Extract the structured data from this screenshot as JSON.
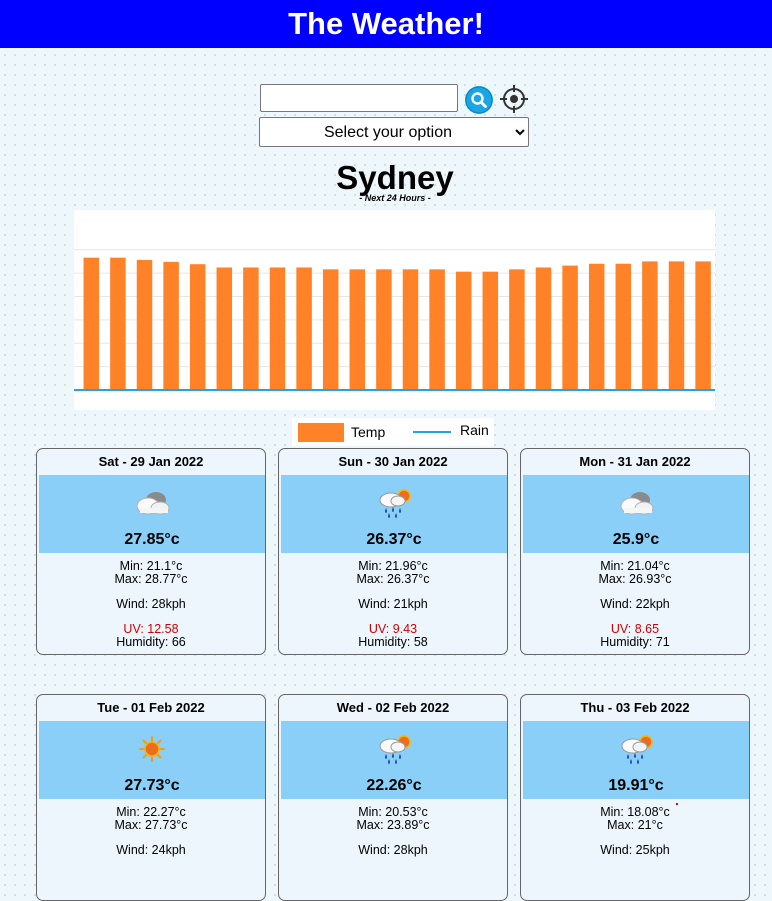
{
  "header": {
    "title": "The Weather!"
  },
  "search": {
    "value": "",
    "placeholder": ""
  },
  "select": {
    "selected": "Select your option"
  },
  "location": {
    "city": "Sydney",
    "subtitle": "- Next 24 Hours -"
  },
  "chart_data": {
    "type": "bar",
    "series": [
      {
        "name": "Temp",
        "type": "bar",
        "color": "#ff8128",
        "values": [
          28.3,
          28.3,
          27.8,
          27.4,
          26.9,
          26.2,
          26.2,
          26.2,
          26.2,
          25.8,
          25.8,
          25.8,
          25.8,
          25.8,
          25.3,
          25.3,
          25.8,
          26.2,
          26.6,
          27.0,
          27.0,
          27.5,
          27.5,
          27.5
        ]
      },
      {
        "name": "Rain",
        "type": "line",
        "color": "#22a3e6",
        "values": [
          0,
          0,
          0,
          0,
          0,
          0,
          0,
          0,
          0,
          0,
          0,
          0,
          0,
          0,
          0,
          0,
          0,
          0,
          0,
          0,
          0,
          0,
          0,
          0
        ]
      }
    ],
    "ylim": [
      0,
      34
    ],
    "grid": true,
    "legend": "bottom-center"
  },
  "legend": {
    "temp": "Temp",
    "rain": "Rain"
  },
  "forecast": [
    {
      "date": "Sat - 29 Jan 2022",
      "icon": "cloud-icon",
      "temp": "27.85°c",
      "min": "Min: 21.1°c",
      "max": "Max: 28.77°c",
      "wind": "Wind: 28kph",
      "uv": "UV: 12.58",
      "humidity": "Humidity: 66"
    },
    {
      "date": "Sun - 30 Jan 2022",
      "icon": "rain-sun-icon",
      "temp": "26.37°c",
      "min": "Min: 21.96°c",
      "max": "Max: 26.37°c",
      "wind": "Wind: 21kph",
      "uv": "UV: 9.43",
      "humidity": "Humidity: 58"
    },
    {
      "date": "Mon - 31 Jan 2022",
      "icon": "cloud-icon",
      "temp": "25.9°c",
      "min": "Min: 21.04°c",
      "max": "Max: 26.93°c",
      "wind": "Wind: 22kph",
      "uv": "UV: 8.65",
      "humidity": "Humidity: 71"
    },
    {
      "date": "Tue - 01 Feb 2022",
      "icon": "sun-icon",
      "temp": "27.73°c",
      "min": "Min: 22.27°c",
      "max": "Max: 27.73°c",
      "wind": "Wind: 24kph",
      "uv": "",
      "humidity": ""
    },
    {
      "date": "Wed - 02 Feb 2022",
      "icon": "rain-sun-icon",
      "temp": "22.26°c",
      "min": "Min: 20.53°c",
      "max": "Max: 23.89°c",
      "wind": "Wind: 28kph",
      "uv": "",
      "humidity": ""
    },
    {
      "date": "Thu - 03 Feb 2022",
      "icon": "rain-sun-icon",
      "temp": "19.91°c",
      "min": "Min: 18.08°c",
      "max": "Max: 21°c",
      "wind": "Wind: 25kph",
      "uv": "",
      "humidity": ""
    }
  ]
}
